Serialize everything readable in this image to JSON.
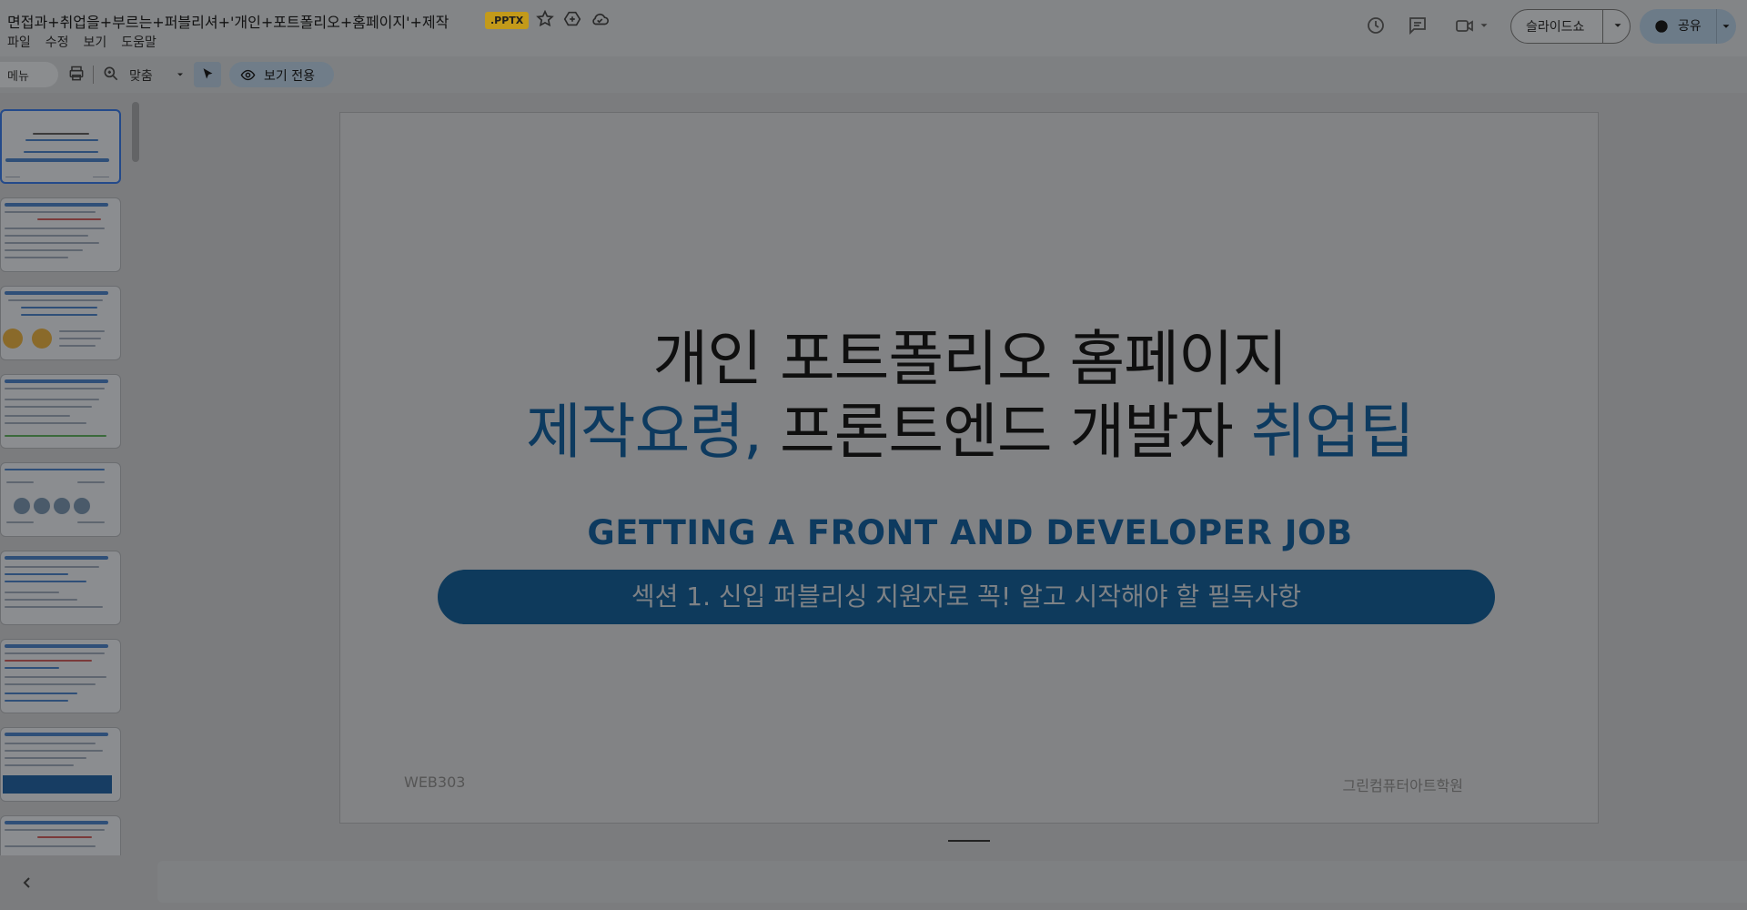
{
  "doc": {
    "title": "면접과+취업을+부르는+퍼블리셔+'개인+포트폴리오+홈페이지'+제작",
    "format_badge": ".PPTX"
  },
  "menu": [
    "파일",
    "수정",
    "보기",
    "도움말"
  ],
  "header": {
    "slideshow_label": "슬라이드쇼",
    "share_label": "공유"
  },
  "toolbar": {
    "menus_label": "메뉴",
    "zoom_value": "맞춤",
    "view_only_label": "보기 전용"
  },
  "slide": {
    "title_line1": "개인 포트폴리오 홈페이지",
    "title_line2_a": "제작요령,",
    "title_line2_b": " 프론트엔드 개발자 ",
    "title_line2_c": "취업팁",
    "subtitle": "GETTING A FRONT AND DEVELOPER JOB",
    "pill_text": "섹션 1. 신입 퍼블리싱 지원자로 꼭! 알고 시작해야 할 필독사항",
    "footer_left": "WEB303",
    "footer_right": "그린컴퓨터아트학원"
  },
  "thumbnails": [
    {
      "type": "title"
    },
    {
      "type": "text"
    },
    {
      "type": "circles"
    },
    {
      "type": "text"
    },
    {
      "type": "diagram"
    },
    {
      "type": "text"
    },
    {
      "type": "text"
    },
    {
      "type": "box"
    },
    {
      "type": "text"
    }
  ],
  "colors": {
    "accent_blue": "#0d3a5f",
    "overlay": "#7b7c7e"
  }
}
